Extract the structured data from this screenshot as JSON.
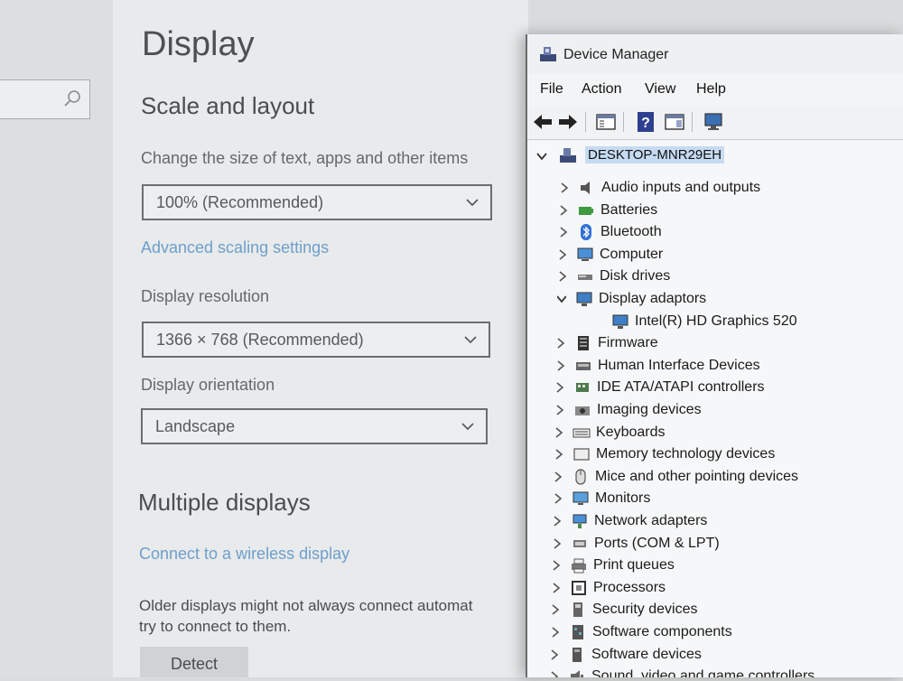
{
  "settings": {
    "page_title": "Display",
    "scale_section": {
      "title": "Scale and layout",
      "size_label": "Change the size of text, apps and other items",
      "size_value": "100% (Recommended)",
      "advanced_link": "Advanced scaling settings",
      "resolution_label": "Display resolution",
      "resolution_value": "1366 × 768 (Recommended)",
      "orientation_label": "Display orientation",
      "orientation_value": "Landscape"
    },
    "multiple_section": {
      "title": "Multiple displays",
      "wireless_link": "Connect to a wireless display",
      "older_text_line1": "Older displays might not always connect automat",
      "older_text_line2": "try to connect to them.",
      "detect_button": "Detect"
    }
  },
  "device_manager": {
    "title": "Device Manager",
    "menu": [
      "File",
      "Action",
      "View",
      "Help"
    ],
    "root": "DESKTOP-MNR29EH",
    "items": [
      {
        "label": "Audio inputs and outputs",
        "icon": "speaker-icon",
        "expanded": false
      },
      {
        "label": "Batteries",
        "icon": "battery-icon",
        "expanded": false
      },
      {
        "label": "Bluetooth",
        "icon": "bluetooth-icon",
        "expanded": false
      },
      {
        "label": "Computer",
        "icon": "computer-icon",
        "expanded": false
      },
      {
        "label": "Disk drives",
        "icon": "disk-drive-icon",
        "expanded": false
      },
      {
        "label": "Display adaptors",
        "icon": "display-adapter-icon",
        "expanded": true
      },
      {
        "label": "Intel(R) HD Graphics 520",
        "icon": "display-adapter-icon",
        "child": true
      },
      {
        "label": "Firmware",
        "icon": "firmware-icon",
        "expanded": false
      },
      {
        "label": "Human Interface Devices",
        "icon": "hid-icon",
        "expanded": false
      },
      {
        "label": "IDE ATA/ATAPI controllers",
        "icon": "ide-controller-icon",
        "expanded": false
      },
      {
        "label": "Imaging devices",
        "icon": "camera-icon",
        "expanded": false
      },
      {
        "label": "Keyboards",
        "icon": "keyboard-icon",
        "expanded": false
      },
      {
        "label": "Memory technology devices",
        "icon": "memory-icon",
        "expanded": false
      },
      {
        "label": "Mice and other pointing devices",
        "icon": "mouse-icon",
        "expanded": false
      },
      {
        "label": "Monitors",
        "icon": "monitor-icon",
        "expanded": false
      },
      {
        "label": "Network adapters",
        "icon": "network-icon",
        "expanded": false
      },
      {
        "label": "Ports (COM & LPT)",
        "icon": "port-icon",
        "expanded": false
      },
      {
        "label": "Print queues",
        "icon": "printer-icon",
        "expanded": false
      },
      {
        "label": "Processors",
        "icon": "processor-icon",
        "expanded": false
      },
      {
        "label": "Security devices",
        "icon": "security-icon",
        "expanded": false
      },
      {
        "label": "Software components",
        "icon": "software-component-icon",
        "expanded": false
      },
      {
        "label": "Software devices",
        "icon": "software-device-icon",
        "expanded": false
      },
      {
        "label": "Sound, video and game controllers",
        "icon": "sound-icon",
        "expanded": false
      }
    ]
  },
  "colors": {
    "link": "#6e9fcb",
    "selection": "#c6dbf2",
    "settings_bg": "#e8eaeb"
  }
}
